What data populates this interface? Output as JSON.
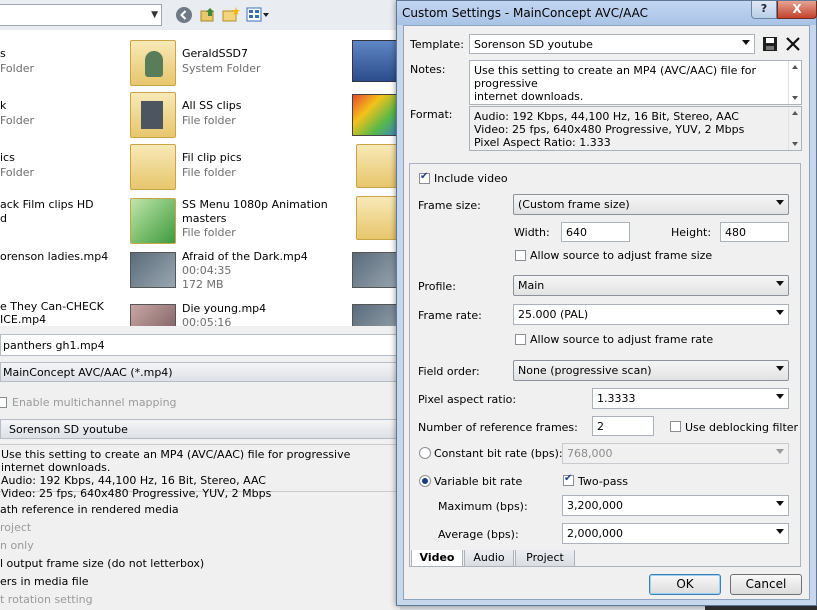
{
  "background": {
    "files": [
      {
        "name": "s",
        "sub": "Folder",
        "icon": "folder-icon"
      },
      {
        "name": "GeraldSSD7",
        "sub": "System Folder",
        "icon": "user-folder-icon"
      },
      {
        "name": "k",
        "sub": "Folder",
        "icon": "folder-icon"
      },
      {
        "name": "All SS clips",
        "sub": "File folder",
        "icon": "folder-icon"
      },
      {
        "name": "ics",
        "sub": "Folder",
        "icon": "folder-icon"
      },
      {
        "name": "Fil clip pics",
        "sub": "File folder",
        "icon": "folder-icon"
      },
      {
        "name": "ack Film clips HD",
        "name2": "d",
        "icon": "folder-icon"
      },
      {
        "name": "SS Menu 1080p Animation",
        "name2": "masters",
        "sub": "File folder",
        "icon": "folder-icon"
      },
      {
        "name": "orenson ladies.mp4",
        "icon": "video-thumbnail-icon"
      },
      {
        "name": "Afraid of the Dark.mp4",
        "sub": "00:04:35",
        "sub2": "172 MB",
        "icon": "video-thumbnail-icon"
      },
      {
        "name": "e They Can-CHECK",
        "name2": "ICE.mp4",
        "icon": "video-thumbnail-icon"
      },
      {
        "name": "Die young.mp4",
        "sub": "00:05:16",
        "icon": "video-thumbnail-icon"
      }
    ],
    "filename": "panthers gh1.mp4",
    "format": "MainConcept AVC/AAC (*.mp4)",
    "multichannel": "Enable multichannel mapping",
    "template": "Sorenson SD youtube",
    "description": "Use this setting to create an MP4 (AVC/AAC) file for progressive internet downloads.\nAudio: 192 Kbps, 44,100 Hz, 16 Bit, Stereo, AAC\nVideo: 25 fps, 640x480 Progressive, YUV, 2 Mbps",
    "options": [
      "ath reference in rendered media",
      "roject",
      "n only",
      "l output frame size (do not letterbox)",
      "ers in media file",
      "t rotation setting"
    ]
  },
  "dialog": {
    "title": "Custom Settings - MainConcept AVC/AAC",
    "help": "?",
    "close": "X",
    "template_label": "Template:",
    "template_value": "Sorenson SD youtube",
    "notes_label": "Notes:",
    "notes_value": "Use this setting to create an MP4 (AVC/AAC) file for progressive\ninternet downloads.",
    "format_label": "Format:",
    "format_value": "Audio: 192 Kbps, 44,100 Hz, 16 Bit, Stereo, AAC\nVideo: 25 fps, 640x480 Progressive, YUV, 2 Mbps\nPixel Aspect Ratio: 1.333",
    "include_video": "Include video",
    "frame_size_label": "Frame size:",
    "frame_size_value": "(Custom frame size)",
    "width_label": "Width:",
    "width_value": "640",
    "height_label": "Height:",
    "height_value": "480",
    "allow_frame_size": "Allow source to adjust frame size",
    "profile_label": "Profile:",
    "profile_value": "Main",
    "frame_rate_label": "Frame rate:",
    "frame_rate_value": "25.000 (PAL)",
    "allow_frame_rate": "Allow source to adjust frame rate",
    "field_order_label": "Field order:",
    "field_order_value": "None (progressive scan)",
    "par_label": "Pixel aspect ratio:",
    "par_value": "1.3333",
    "ref_frames_label": "Number of reference frames:",
    "ref_frames_value": "2",
    "deblock_label": "Use deblocking filter",
    "cbr_label": "Constant bit rate (bps):",
    "cbr_value": "768,000",
    "vbr_label": "Variable bit rate",
    "two_pass_label": "Two-pass",
    "max_label": "Maximum (bps):",
    "max_value": "3,200,000",
    "avg_label": "Average (bps):",
    "avg_value": "2,000,000",
    "tabs": [
      "Video",
      "Audio",
      "Project"
    ],
    "ok": "OK",
    "cancel": "Cancel"
  },
  "colors": {
    "title_bar": "#a9c3e6",
    "close_button": "#c4422b",
    "check_mark": "#1d3d8f"
  }
}
